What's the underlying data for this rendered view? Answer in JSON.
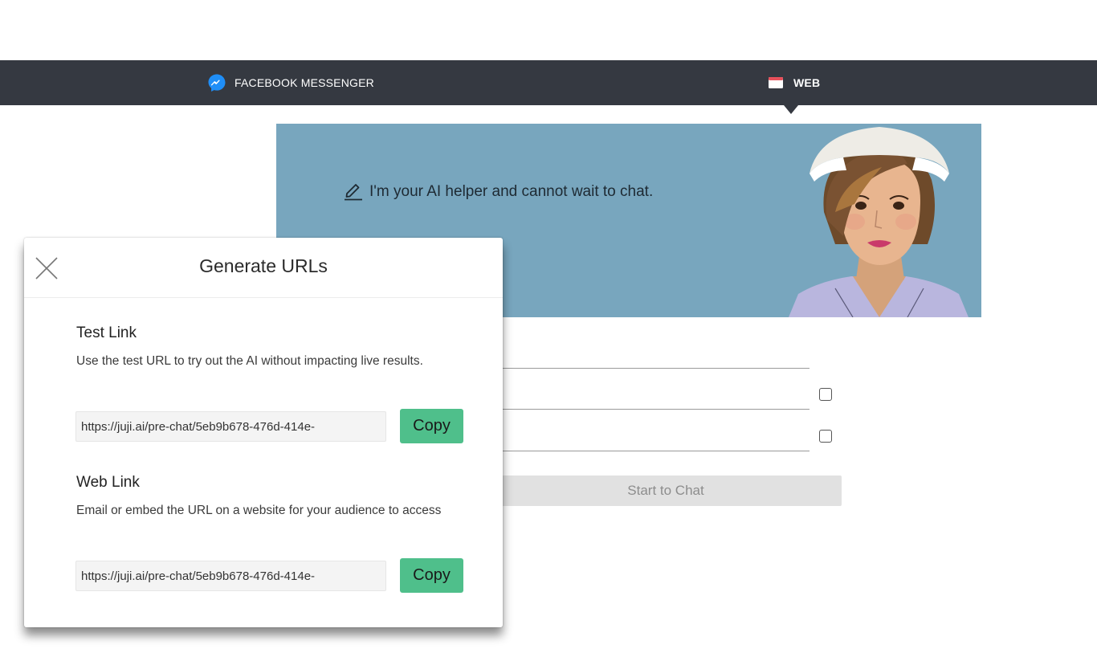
{
  "nav": {
    "facebook_label": "FACEBOOK MESSENGER",
    "web_label": "WEB"
  },
  "banner": {
    "greeting": "I'm your AI helper and cannot wait to chat."
  },
  "form": {
    "start_label": "Start to Chat"
  },
  "modal": {
    "title": "Generate URLs",
    "test": {
      "title": "Test Link",
      "description": "Use the test URL to try out the AI without impacting live results.",
      "url": "https://juji.ai/pre-chat/5eb9b678-476d-414e-",
      "copy_label": "Copy"
    },
    "web": {
      "title": "Web Link",
      "description": "Email or embed the URL on a website for your audience to access",
      "url": "https://juji.ai/pre-chat/5eb9b678-476d-414e-",
      "copy_label": "Copy"
    }
  },
  "colors": {
    "nav_bg": "#353941",
    "banner_bg": "#78a6be",
    "copy_button": "#4fbf8b",
    "messenger_blue": "#1f8ef7"
  }
}
